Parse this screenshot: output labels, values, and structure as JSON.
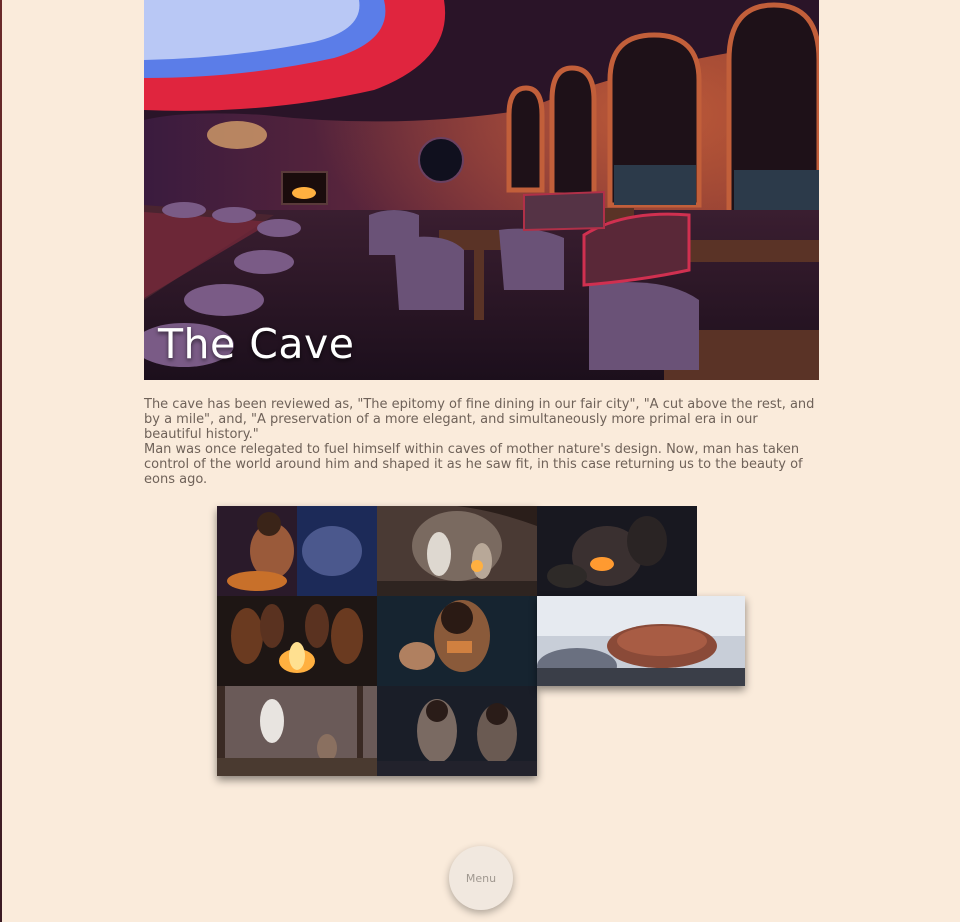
{
  "hero": {
    "title": "The Cave",
    "image": "restaurant-interior-photo"
  },
  "content": {
    "paragraph1": "The cave has been reviewed as, \"The epitomy of fine dining in our fair city\", \"A cut above the rest, and by a mile\", and, \"A preservation of a more elegant, and simultaneously more primal era in our beautiful history.\"",
    "paragraph2": "Man was once relegated to fuel himself within caves of mother nature's design. Now, man has taken control of the world around him and shaped it as he saw fit, in this case returning us to the beauty of eons ago."
  },
  "gallery": {
    "tiles": [
      "cave-person-crouching-photo",
      "cave-group-gathered-photo",
      "cave-fire-dark-photo",
      "campfire-group-photo",
      "cave-person-eating-photo",
      "grilled-steak-photo",
      "forest-camp-photo",
      "cave-family-photo"
    ]
  },
  "menu": {
    "label": "Menu"
  },
  "colors": {
    "background": "#faebdb",
    "text": "#6f6259",
    "menu_button": "#f1e8df"
  }
}
